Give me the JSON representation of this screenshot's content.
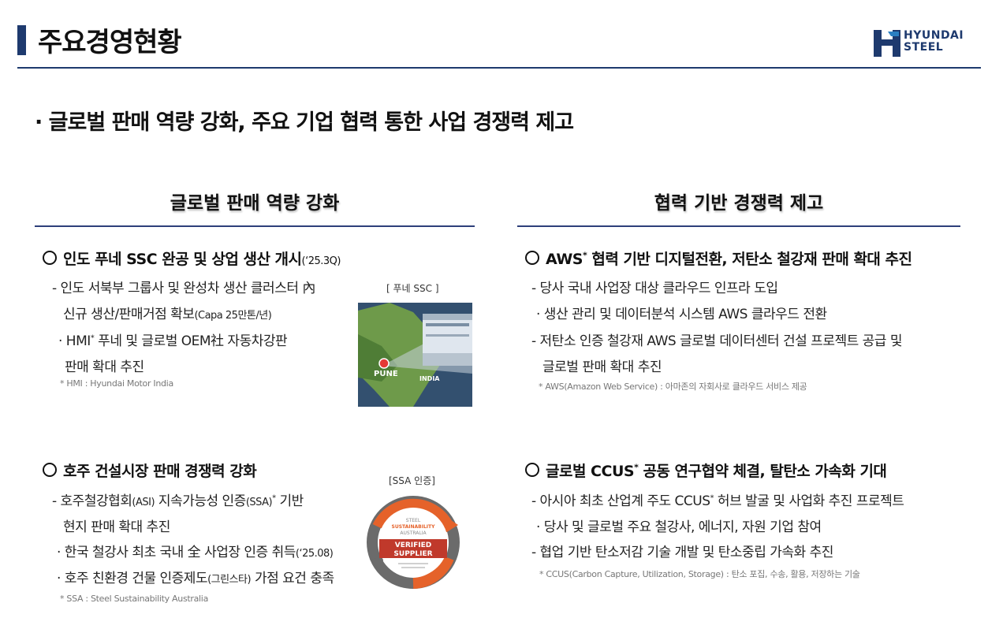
{
  "page_title": "주요경영현황",
  "logo": {
    "line1": "HYUNDAI",
    "line2": "STEEL"
  },
  "headline": "· 글로벌 판매 역량 강화, 주요 기업 협력 통한 사업 경쟁력 제고",
  "left": {
    "heading": "글로벌 판매 역량 강화",
    "block1": {
      "title": "인도 푸네 SSC 완공 및 상업 생산 개시",
      "title_suffix": "(‘25.3Q)",
      "l1": "- 인도 서북부 그룹사 및 완성차 생산 클러스터 內",
      "l2a": "신규 생산/판매거점 확보",
      "l2b": "(Capa 25만톤/년)",
      "l3a": "· HMI",
      "l3sup": "*",
      "l3b": " 푸네 및 글로벌 OEM社 자동차강판",
      "l4": "판매 확대 추진",
      "note": "* HMI : Hyundai Motor India",
      "img_label": "[ 푸네 SSC ]",
      "map_pune": "PUNE",
      "map_india": "INDIA"
    },
    "block2": {
      "title": "호주 건설시장 판매 경쟁력 강화",
      "l1a": "- 호주철강협회",
      "l1b": "(ASI)",
      "l1c": " 지속가능성 인증",
      "l1d": "(SSA)",
      "l1sup": "*",
      "l1e": " 기반",
      "l2": "현지 판매 확대 추진",
      "l3a": "· 한국 철강사 최초 국내 全 사업장 인증 취득",
      "l3b": "(‘25.08)",
      "l4a": "· 호주 친환경 건물 인증제도",
      "l4b": "(그린스타)",
      "l4c": " 가점 요건 충족",
      "note": "* SSA : Steel Sustainability Australia",
      "img_label": "[SSA 인증]",
      "badge_top1": "STEEL",
      "badge_top2": "SUSTAINABILITY",
      "badge_top3": "AUSTRALIA",
      "badge_mid1": "VERIFIED",
      "badge_mid2": "SUPPLIER"
    }
  },
  "right": {
    "heading": "협력 기반 경쟁력 제고",
    "block1": {
      "title_a": "AWS",
      "title_sup": "*",
      "title_b": " 협력 기반 디지털전환, 저탄소 철강재 판매 확대 추진",
      "l1": "- 당사 국내 사업장 대상 클라우드 인프라 도입",
      "l2": "· 생산 관리 및 데이터분석 시스템 AWS 클라우드 전환",
      "l3": "- 저탄소 인증 철강재 AWS 글로벌 데이터센터 건설 프로젝트 공급 및",
      "l4": "글로벌 판매 확대 추진",
      "note": "* AWS(Amazon Web Service) : 아마존의 자회사로 클라우드 서비스 제공"
    },
    "block2": {
      "title_a": "글로벌 CCUS",
      "title_sup": "*",
      "title_b": " 공동 연구협약 체결, 탈탄소 가속화 기대",
      "l1a": "- 아시아 최초 산업계 주도 CCUS",
      "l1sup": "*",
      "l1b": " 허브 발굴 및 사업화 추진 프로젝트",
      "l2": "· 당사 및 글로벌 주요 철강사, 에너지, 자원 기업 참여",
      "l3": "- 협업 기반 탄소저감 기술 개발 및 탄소중립 가속화 추진",
      "note": "* CCUS(Carbon Capture, Utilization, Storage) : 탄소 포집, 수송, 활용, 저장하는 기술"
    }
  },
  "colors": {
    "navy": "#1e3a6e",
    "accent_orange": "#e5622a",
    "badge_red": "#c0392b"
  }
}
